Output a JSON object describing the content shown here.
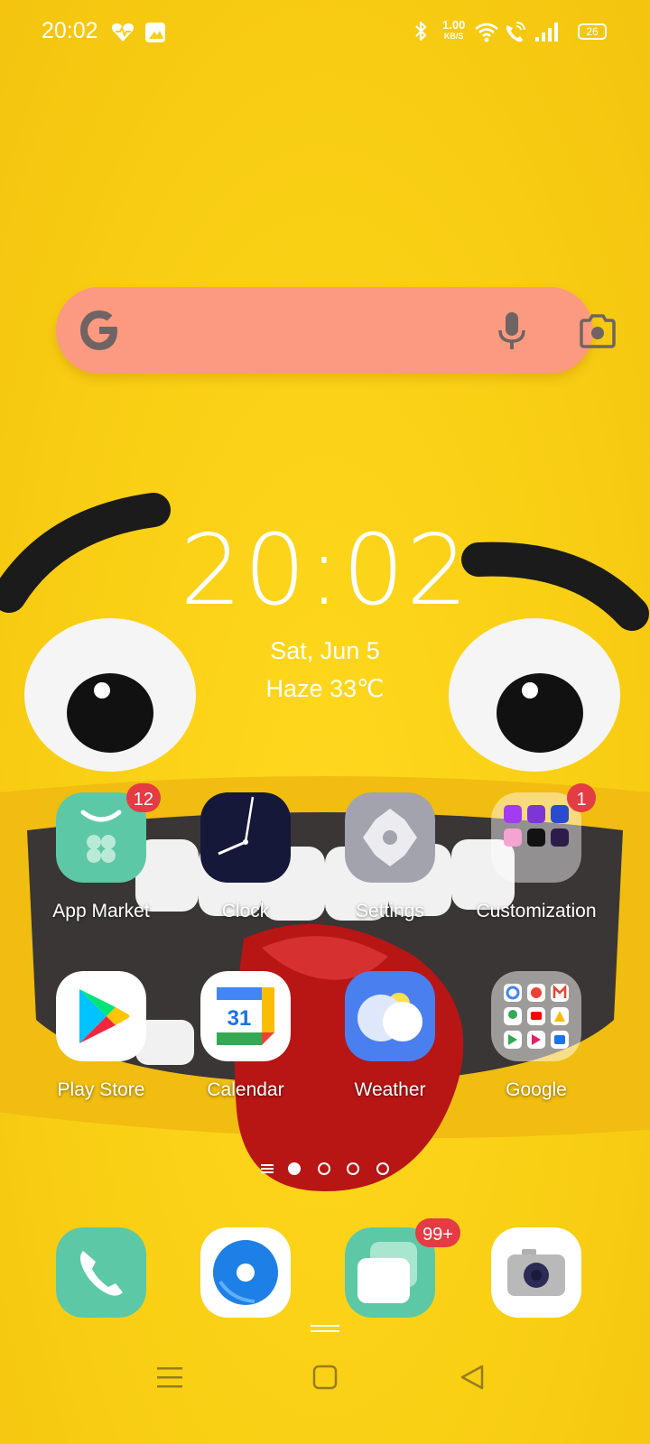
{
  "status_bar": {
    "time": "20:02",
    "net_speed_value": "1.00",
    "net_speed_unit": "KB/S",
    "battery": "26",
    "icons": [
      "heart-health-icon",
      "gallery-notification-icon",
      "bluetooth-icon",
      "wifi-icon",
      "wifi-calling-icon",
      "signal-icon",
      "battery-icon"
    ]
  },
  "search_bar": {
    "icons": [
      "google-logo-icon",
      "microphone-icon",
      "camera-lens-icon"
    ]
  },
  "clock_widget": {
    "time": "20:02",
    "date": "Sat, Jun 5",
    "weather": "Haze 33℃"
  },
  "apps": [
    {
      "label": "App Market",
      "badge": "12",
      "icon": "app-market-icon"
    },
    {
      "label": "Clock",
      "badge": "",
      "icon": "clock-icon"
    },
    {
      "label": "Settings",
      "badge": "",
      "icon": "settings-gear-icon"
    },
    {
      "label": "Customization",
      "badge": "1",
      "icon": "customization-folder-icon"
    },
    {
      "label": "Play Store",
      "badge": "",
      "icon": "play-store-icon"
    },
    {
      "label": "Calendar",
      "badge": "",
      "icon": "calendar-icon",
      "day": "31"
    },
    {
      "label": "Weather",
      "badge": "",
      "icon": "weather-icon"
    },
    {
      "label": "Google",
      "badge": "",
      "icon": "google-folder-icon"
    }
  ],
  "dock": [
    {
      "name": "phone",
      "badge": "",
      "icon": "phone-icon"
    },
    {
      "name": "browser",
      "badge": "",
      "icon": "browser-icon"
    },
    {
      "name": "messages",
      "badge": "99+",
      "icon": "messages-icon"
    },
    {
      "name": "camera",
      "badge": "",
      "icon": "camera-icon"
    }
  ],
  "pager": {
    "pages": 4,
    "active": 1
  },
  "colors": {
    "wallpaper": "#f9cf14",
    "search_bar": "#fb9a80",
    "badge": "#e43b44",
    "app_market": "#5dc8a5",
    "clock_bg": "#16183a",
    "settings_bg": "#a2a3ac",
    "weather_bg": "#4a7ff0"
  }
}
